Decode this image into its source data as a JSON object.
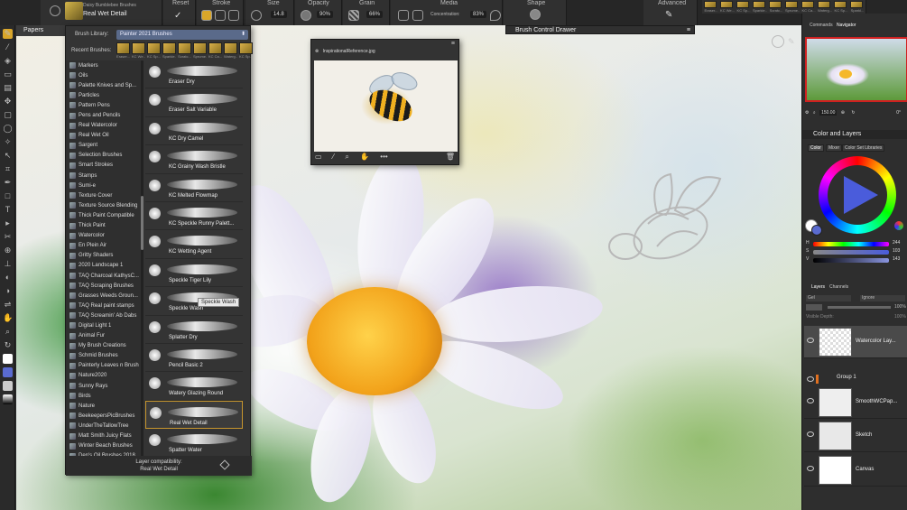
{
  "toolbar": {
    "brush_category": "Daisy Bumblebee Brushes",
    "brush_variant": "Real Wet Detail",
    "reset_label": "Reset",
    "stroke_label": "Stroke",
    "size_label": "Size",
    "size_value": "14.8",
    "opacity_label": "Opacity",
    "opacity_value": "90%",
    "grain_label": "Grain",
    "grain_value": "66%",
    "media_label": "Media",
    "concentration_label": "Concentration:",
    "concentration_value": "83%",
    "shape_label": "Shape",
    "advanced_label": "Advanced",
    "recent_top": [
      "Eraser...",
      "KC We...",
      "KC Sp...",
      "Sparkle...",
      "Scratc...",
      "Sprume...",
      "KC Ca...",
      "Waterg...",
      "KC Sp...",
      "Sparkl..."
    ]
  },
  "papers_label": "Papers",
  "brush_selector": {
    "library_label": "Brush Library:",
    "library_value": "Painter 2021 Brushes",
    "recent_label": "Recent Brushes:",
    "recent": [
      "Eraser...",
      "KC We...",
      "KC Sp...",
      "Sparkle...",
      "Scratc...",
      "Sprume...",
      "KC Ca...",
      "Waterg...",
      "KC Sp..."
    ],
    "categories": [
      "Markers",
      "Oils",
      "Palette Knives and Sp...",
      "Particles",
      "Pattern Pens",
      "Pens and Pencils",
      "Real Watercolor",
      "Real Wet Oil",
      "Sargent",
      "Selection Brushes",
      "Smart Strokes",
      "Stamps",
      "Sumi-e",
      "Texture Cover",
      "Texture Source Blending",
      "Thick Paint Compatible",
      "Thick Paint",
      "Watercolor",
      "En Plein Air",
      "Gritty Shaders",
      "2020 Landscape 1",
      "TAQ Charcoal KathysC...",
      "TAQ Scraping Brushes",
      "Grasses Weeds Groun...",
      "TAQ Real paint stamps",
      "TAQ Screamin' Ab Dabs",
      "Digital Light 1",
      "Animal Fur",
      "My Brush Creations",
      "Schmid Brushes",
      "Painterly Leaves n Brush",
      "Nature2020",
      "Sunny Rays",
      "Birds",
      "Nature",
      "BeekeepersPicBrushes",
      "UnderTheTallowTree",
      "Matt Smith Juicy Flats",
      "Winter Beach Brushes",
      "Den's Oil Brushes 2018"
    ],
    "variants": [
      "Eraser Dry",
      "Eraser Salt Variable",
      "KC Dry Camel",
      "KC Grainy Wash Bristle",
      "KC Melted Flowmap",
      "KC Speckle Runny Palett...",
      "KC Wetting Agent",
      "Speckle Tiger Lily",
      "Speckle Wash",
      "Splatter Dry",
      "Pencil Basic 2",
      "Watery Glazing Round",
      "Real Wet Detail",
      "Spatter Water"
    ],
    "tooltip": "Speckle Wash",
    "compat_label": "Layer compatibility:",
    "compat_value": "Real Wet Detail"
  },
  "reference": {
    "filename": "InspirationalReference.jpg"
  },
  "brush_control_drawer": "Brush Control Drawer",
  "right": {
    "commands_tab": "Commands",
    "navigator_tab": "Navigator",
    "zoom_value": "150.00",
    "rotation_value": "0°",
    "color_layers_title": "Color and Layers",
    "color_tabs": [
      "Color",
      "Mixer",
      "Color Set Libraries"
    ],
    "hsv": [
      {
        "label": "H",
        "value": "244"
      },
      {
        "label": "S",
        "value": "103"
      },
      {
        "label": "V",
        "value": "143"
      }
    ],
    "layers_tabs": [
      "Layers",
      "Channels"
    ],
    "blend_mode": "Gel",
    "composite": "Ignore",
    "opacity_value": "100%",
    "visible_depth_label": "Visible Depth:",
    "visible_depth_value": "100%",
    "layers": [
      "Watercolor Lay...",
      "SmoothWCPap...",
      "Sketch",
      "Canvas"
    ],
    "group_label": "Group 1"
  }
}
